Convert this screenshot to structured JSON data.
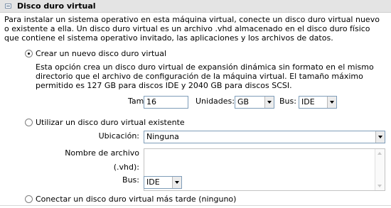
{
  "section": {
    "title": "Disco duro virtual",
    "description": "Para instalar un sistema operativo en esta máquina virtual, conecte un disco duro virtual nuevo o existente a ella. Un disco duro virtual es un archivo .vhd almacenado en el disco duro físico que contiene el sistema operativo invitado, las aplicaciones y los archivos de datos."
  },
  "options": {
    "new_disk": {
      "label": "Crear un nuevo disco duro virtual",
      "selected": true,
      "description": "Esta opción crea un disco duro virtual de expansión dinámica sin formato en el mismo directorio que el archivo de configuración de la máquina virtual. El tamaño máximo permitido es 127 GB para discos IDE y 2040 GB para discos SCSI.",
      "size_label": "Tamaño:",
      "size_value": "16",
      "units_label": "Unidades:",
      "units_value": "GB",
      "bus_label": "Bus:",
      "bus_value": "IDE"
    },
    "existing_disk": {
      "label": "Utilizar un disco duro virtual existente",
      "selected": false,
      "location_label": "Ubicación:",
      "location_value": "Ninguna",
      "filename_label": "Nombre de archivo (.vhd):",
      "filename_value": "",
      "bus_label": "Bus:",
      "bus_value": "IDE"
    },
    "later": {
      "label": "Conectar un disco duro virtual más tarde (ninguno)",
      "selected": false
    }
  }
}
